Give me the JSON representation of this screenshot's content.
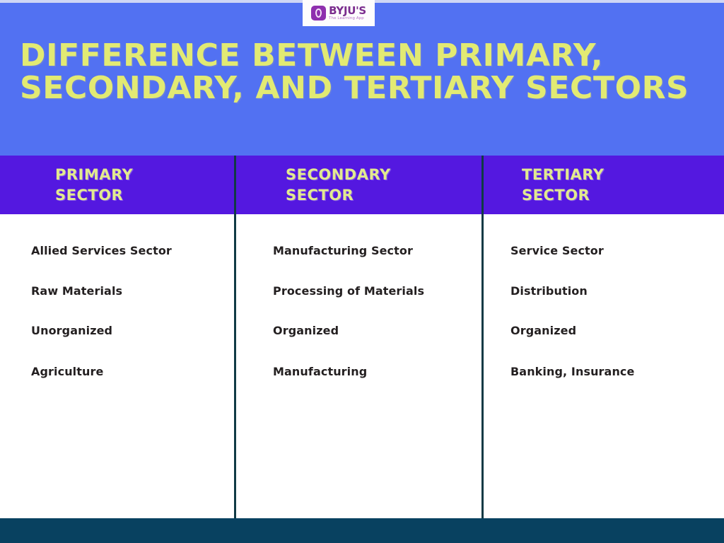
{
  "brand": {
    "logo_icon": "byjus-logo-icon",
    "name": "BYJU'S",
    "tagline": "The Learning App"
  },
  "headline": "DIFFERENCE BETWEEN PRIMARY, SECONDARY, AND TERTIARY SECTORS",
  "colors": {
    "banner_blue": "#5271f2",
    "headline_yellow": "#e2ea73",
    "header_purple": "#5418e0",
    "header_text": "#e2ea8f",
    "divider_teal": "#103a45",
    "bottom_bar": "#084160",
    "body_text": "#231f20",
    "logo_purple": "#7b2d8e"
  },
  "table": {
    "columns": [
      {
        "header_line1": "PRIMARY",
        "header_line2": "SECTOR",
        "items": [
          "Allied Services Sector",
          "Raw Materials",
          "Unorganized",
          "Agriculture"
        ]
      },
      {
        "header_line1": "SECONDARY",
        "header_line2": "SECTOR",
        "items": [
          "Manufacturing Sector",
          "Processing of Materials",
          "Organized",
          "Manufacturing"
        ]
      },
      {
        "header_line1": "TERTIARY",
        "header_line2": "SECTOR",
        "items": [
          "Service Sector",
          "Distribution",
          "Organized",
          "Banking, Insurance"
        ]
      }
    ]
  }
}
